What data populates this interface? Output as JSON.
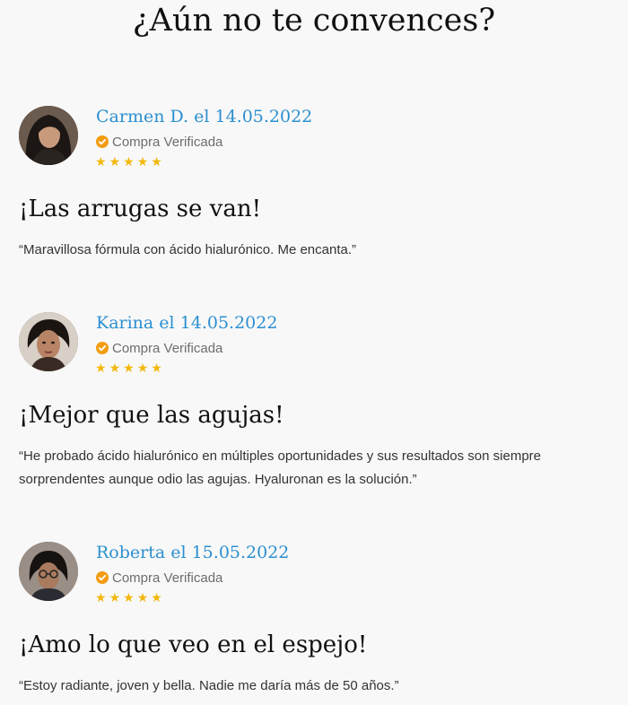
{
  "page": {
    "title": "¿Aún no te convences?"
  },
  "badge": {
    "verified_label": "Compra Verificada",
    "icon": "verified-check-icon",
    "color": "#f39c12"
  },
  "rating": {
    "star_icon": "star-icon",
    "star_color": "#f2b80c",
    "stars_shown": 5,
    "star_glyph": "★"
  },
  "reviews": [
    {
      "author_line": "Carmen D. el 14.05.2022",
      "title": "¡Las arrugas se van!",
      "text": "“Maravillosa fórmula con ácido hialurónico. Me encanta.”"
    },
    {
      "author_line": "Karina el 14.05.2022",
      "title": "¡Mejor que las agujas!",
      "text": "“He probado ácido hialurónico en múltiples oportunidades y sus resultados son siempre sorprendentes aunque odio las agujas. Hyaluronan es la solución.”"
    },
    {
      "author_line": "Roberta el 15.05.2022",
      "title": "¡Amo lo que veo en el espejo!",
      "text": "“Estoy radiante, joven y bella. Nadie me daría más de 50 años.”"
    }
  ]
}
